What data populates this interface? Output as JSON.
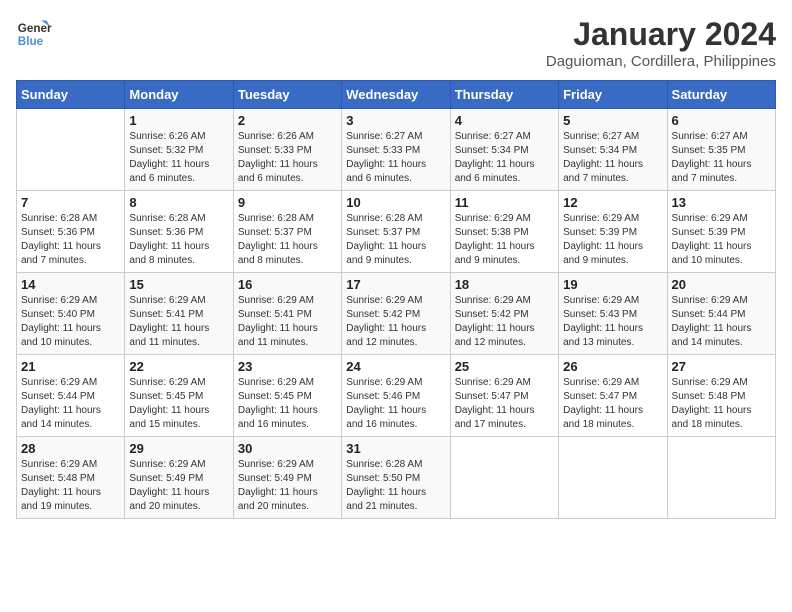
{
  "logo": {
    "line1": "General",
    "line2": "Blue"
  },
  "title": "January 2024",
  "subtitle": "Daguioman, Cordillera, Philippines",
  "days_of_week": [
    "Sunday",
    "Monday",
    "Tuesday",
    "Wednesday",
    "Thursday",
    "Friday",
    "Saturday"
  ],
  "weeks": [
    [
      {
        "num": "",
        "info": ""
      },
      {
        "num": "1",
        "info": "Sunrise: 6:26 AM\nSunset: 5:32 PM\nDaylight: 11 hours\nand 6 minutes."
      },
      {
        "num": "2",
        "info": "Sunrise: 6:26 AM\nSunset: 5:33 PM\nDaylight: 11 hours\nand 6 minutes."
      },
      {
        "num": "3",
        "info": "Sunrise: 6:27 AM\nSunset: 5:33 PM\nDaylight: 11 hours\nand 6 minutes."
      },
      {
        "num": "4",
        "info": "Sunrise: 6:27 AM\nSunset: 5:34 PM\nDaylight: 11 hours\nand 6 minutes."
      },
      {
        "num": "5",
        "info": "Sunrise: 6:27 AM\nSunset: 5:34 PM\nDaylight: 11 hours\nand 7 minutes."
      },
      {
        "num": "6",
        "info": "Sunrise: 6:27 AM\nSunset: 5:35 PM\nDaylight: 11 hours\nand 7 minutes."
      }
    ],
    [
      {
        "num": "7",
        "info": "Sunrise: 6:28 AM\nSunset: 5:36 PM\nDaylight: 11 hours\nand 7 minutes."
      },
      {
        "num": "8",
        "info": "Sunrise: 6:28 AM\nSunset: 5:36 PM\nDaylight: 11 hours\nand 8 minutes."
      },
      {
        "num": "9",
        "info": "Sunrise: 6:28 AM\nSunset: 5:37 PM\nDaylight: 11 hours\nand 8 minutes."
      },
      {
        "num": "10",
        "info": "Sunrise: 6:28 AM\nSunset: 5:37 PM\nDaylight: 11 hours\nand 9 minutes."
      },
      {
        "num": "11",
        "info": "Sunrise: 6:29 AM\nSunset: 5:38 PM\nDaylight: 11 hours\nand 9 minutes."
      },
      {
        "num": "12",
        "info": "Sunrise: 6:29 AM\nSunset: 5:39 PM\nDaylight: 11 hours\nand 9 minutes."
      },
      {
        "num": "13",
        "info": "Sunrise: 6:29 AM\nSunset: 5:39 PM\nDaylight: 11 hours\nand 10 minutes."
      }
    ],
    [
      {
        "num": "14",
        "info": "Sunrise: 6:29 AM\nSunset: 5:40 PM\nDaylight: 11 hours\nand 10 minutes."
      },
      {
        "num": "15",
        "info": "Sunrise: 6:29 AM\nSunset: 5:41 PM\nDaylight: 11 hours\nand 11 minutes."
      },
      {
        "num": "16",
        "info": "Sunrise: 6:29 AM\nSunset: 5:41 PM\nDaylight: 11 hours\nand 11 minutes."
      },
      {
        "num": "17",
        "info": "Sunrise: 6:29 AM\nSunset: 5:42 PM\nDaylight: 11 hours\nand 12 minutes."
      },
      {
        "num": "18",
        "info": "Sunrise: 6:29 AM\nSunset: 5:42 PM\nDaylight: 11 hours\nand 12 minutes."
      },
      {
        "num": "19",
        "info": "Sunrise: 6:29 AM\nSunset: 5:43 PM\nDaylight: 11 hours\nand 13 minutes."
      },
      {
        "num": "20",
        "info": "Sunrise: 6:29 AM\nSunset: 5:44 PM\nDaylight: 11 hours\nand 14 minutes."
      }
    ],
    [
      {
        "num": "21",
        "info": "Sunrise: 6:29 AM\nSunset: 5:44 PM\nDaylight: 11 hours\nand 14 minutes."
      },
      {
        "num": "22",
        "info": "Sunrise: 6:29 AM\nSunset: 5:45 PM\nDaylight: 11 hours\nand 15 minutes."
      },
      {
        "num": "23",
        "info": "Sunrise: 6:29 AM\nSunset: 5:45 PM\nDaylight: 11 hours\nand 16 minutes."
      },
      {
        "num": "24",
        "info": "Sunrise: 6:29 AM\nSunset: 5:46 PM\nDaylight: 11 hours\nand 16 minutes."
      },
      {
        "num": "25",
        "info": "Sunrise: 6:29 AM\nSunset: 5:47 PM\nDaylight: 11 hours\nand 17 minutes."
      },
      {
        "num": "26",
        "info": "Sunrise: 6:29 AM\nSunset: 5:47 PM\nDaylight: 11 hours\nand 18 minutes."
      },
      {
        "num": "27",
        "info": "Sunrise: 6:29 AM\nSunset: 5:48 PM\nDaylight: 11 hours\nand 18 minutes."
      }
    ],
    [
      {
        "num": "28",
        "info": "Sunrise: 6:29 AM\nSunset: 5:48 PM\nDaylight: 11 hours\nand 19 minutes."
      },
      {
        "num": "29",
        "info": "Sunrise: 6:29 AM\nSunset: 5:49 PM\nDaylight: 11 hours\nand 20 minutes."
      },
      {
        "num": "30",
        "info": "Sunrise: 6:29 AM\nSunset: 5:49 PM\nDaylight: 11 hours\nand 20 minutes."
      },
      {
        "num": "31",
        "info": "Sunrise: 6:28 AM\nSunset: 5:50 PM\nDaylight: 11 hours\nand 21 minutes."
      },
      {
        "num": "",
        "info": ""
      },
      {
        "num": "",
        "info": ""
      },
      {
        "num": "",
        "info": ""
      }
    ]
  ]
}
